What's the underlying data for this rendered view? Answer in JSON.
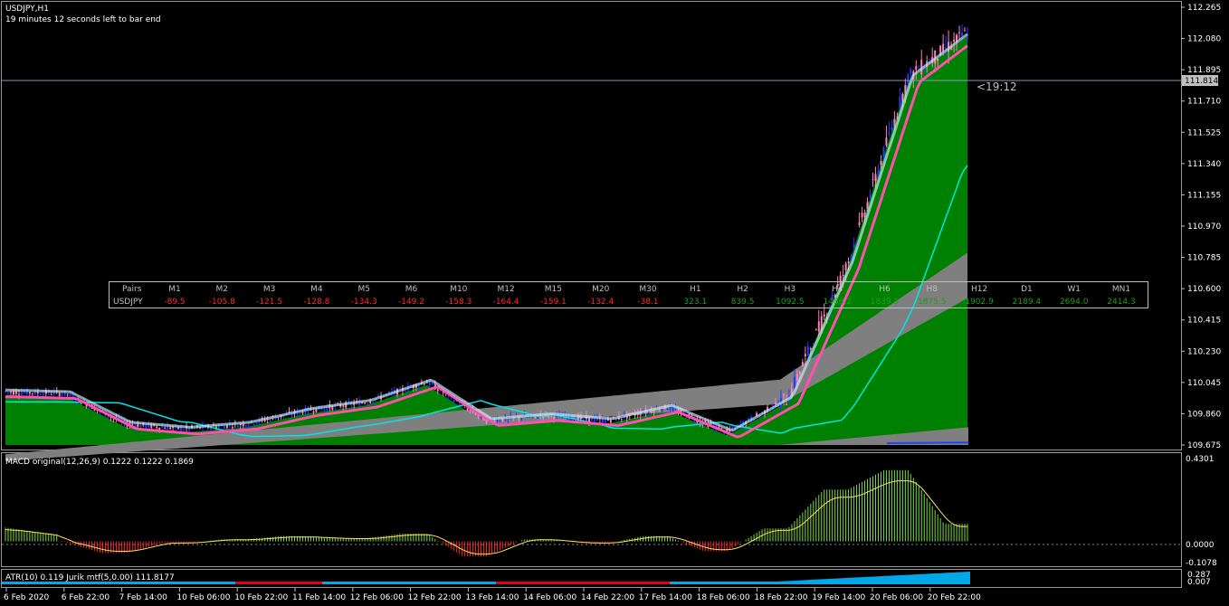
{
  "header": {
    "symbol_tf": "USDJPY,H1",
    "countdown": "19 minutes 12 seconds left to bar end"
  },
  "price_axis": {
    "ticks": [
      "112.265",
      "112.080",
      "111.895",
      "111.710",
      "111.525",
      "111.340",
      "111.155",
      "110.970",
      "110.785",
      "110.600",
      "110.415",
      "110.230",
      "110.045",
      "109.860",
      "109.675"
    ],
    "current_price": "111.814",
    "bar_timer": "<19:12"
  },
  "time_axis": {
    "labels": [
      "6 Feb 2020",
      "6 Feb 22:00",
      "7 Feb 14:00",
      "10 Feb 06:00",
      "10 Feb 22:00",
      "11 Feb 14:00",
      "12 Feb 06:00",
      "12 Feb 22:00",
      "13 Feb 14:00",
      "14 Feb 06:00",
      "14 Feb 22:00",
      "17 Feb 14:00",
      "18 Feb 06:00",
      "18 Feb 22:00",
      "19 Feb 14:00",
      "20 Feb 06:00",
      "20 Feb 22:00"
    ]
  },
  "strength_table": {
    "header_label": "Pairs",
    "row_label": "USDJPY",
    "columns": [
      "M1",
      "M2",
      "M3",
      "M4",
      "M5",
      "M6",
      "M10",
      "M12",
      "M15",
      "M20",
      "M30",
      "H1",
      "H2",
      "H3",
      "H4",
      "H6",
      "H8",
      "H12",
      "D1",
      "W1",
      "MN1"
    ],
    "values": [
      "-89.5",
      "-105.8",
      "-121.5",
      "-128.8",
      "-134.3",
      "-149.2",
      "-158.3",
      "-164.4",
      "-159.1",
      "-132.4",
      "-38.1",
      "323.1",
      "839.5",
      "1092.5",
      "1486.2",
      "1839.5",
      "1875.5",
      "1902.9",
      "2189.4",
      "2694.0",
      "2414.3"
    ],
    "positive_color": "#1e9e1e",
    "negative_color": "#ff2a2a"
  },
  "macd_panel": {
    "label": "MACD original(12,26,9) 0.1222 0.1222 0.1869",
    "ticks": [
      "0.4301",
      "0.0000",
      "-0.1078"
    ]
  },
  "atr_panel": {
    "label": "ATR(10) 0.119 Jurik mtf(5,0.00) 111.8177",
    "ticks": [
      "0.287",
      "0.007"
    ]
  },
  "colors": {
    "up_candle": "#1f3cff",
    "down_candle": "#ff7fbf",
    "fill_green": "#008000",
    "cyan_line": "#00e5e5",
    "grey_band": "#7f7f7f",
    "macd_up": "#7ddc3a",
    "macd_down": "#ff2020",
    "signal": "#ffe066",
    "atr_blue": "#00a8e8",
    "atr_red": "#e0001a"
  },
  "chart_data": {
    "type": "candlestick",
    "symbol": "USDJPY",
    "timeframe": "H1",
    "ylim": [
      109.58,
      112.33
    ],
    "grid": false,
    "key_points": [
      {
        "t": "6 Feb 2020",
        "price": 109.99
      },
      {
        "t": "6 Feb 22:00",
        "price": 109.98
      },
      {
        "t": "7 Feb 14:00",
        "price": 109.8
      },
      {
        "t": "10 Feb 06:00",
        "price": 109.77
      },
      {
        "t": "10 Feb 22:00",
        "price": 109.8
      },
      {
        "t": "11 Feb 14:00",
        "price": 109.88
      },
      {
        "t": "12 Feb 06:00",
        "price": 109.93
      },
      {
        "t": "12 Feb 22:00",
        "price": 110.05
      },
      {
        "t": "13 Feb 14:00",
        "price": 109.82
      },
      {
        "t": "14 Feb 06:00",
        "price": 109.85
      },
      {
        "t": "14 Feb 22:00",
        "price": 109.82
      },
      {
        "t": "17 Feb 14:00",
        "price": 109.9
      },
      {
        "t": "18 Feb 06:00",
        "price": 109.75
      },
      {
        "t": "18 Feb 22:00",
        "price": 109.95
      },
      {
        "t": "19 Feb 14:00",
        "price": 110.75
      },
      {
        "t": "20 Feb 06:00",
        "price": 111.85
      },
      {
        "t": "20 Feb 22:00",
        "price": 112.12
      }
    ],
    "current_price": 111.814,
    "macd_ylim": [
      -0.1078,
      0.4301
    ]
  }
}
